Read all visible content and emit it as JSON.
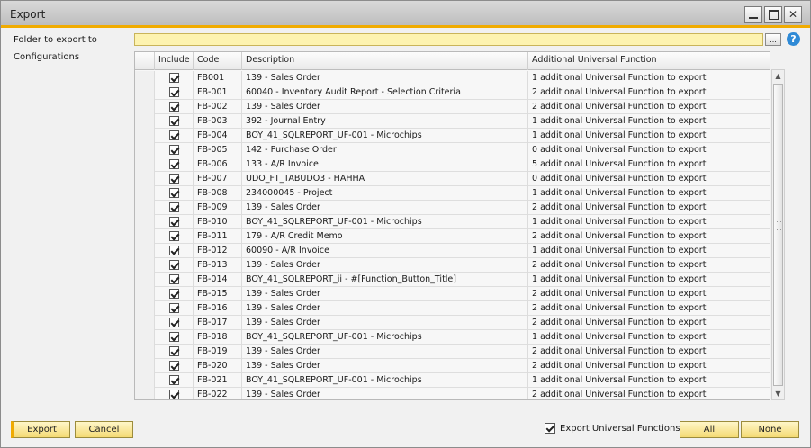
{
  "window": {
    "title": "Export"
  },
  "form": {
    "folder_label": "Folder to export to",
    "folder_value": "",
    "browse_label": "...",
    "help_label": "?",
    "configs_label": "Configurations"
  },
  "grid": {
    "columns": [
      "Include",
      "Code",
      "Description",
      "Additional Universal Function"
    ],
    "rows": [
      {
        "include": true,
        "code": "FB001",
        "description": "139 - Sales Order",
        "additional": "1 additional Universal Function to export"
      },
      {
        "include": true,
        "code": "FB-001",
        "description": "60040 - Inventory Audit Report - Selection Criteria",
        "additional": "2 additional Universal Function to export"
      },
      {
        "include": true,
        "code": "FB-002",
        "description": "139 - Sales Order",
        "additional": "2 additional Universal Function to export"
      },
      {
        "include": true,
        "code": "FB-003",
        "description": "392 - Journal Entry",
        "additional": "1 additional Universal Function to export"
      },
      {
        "include": true,
        "code": "FB-004",
        "description": "BOY_41_SQLREPORT_UF-001 - Microchips",
        "additional": "1 additional Universal Function to export"
      },
      {
        "include": true,
        "code": "FB-005",
        "description": "142 - Purchase Order",
        "additional": "0 additional Universal Function to export"
      },
      {
        "include": true,
        "code": "FB-006",
        "description": "133 - A/R Invoice",
        "additional": "5 additional Universal Function to export"
      },
      {
        "include": true,
        "code": "FB-007",
        "description": "UDO_FT_TABUDO3 - HAHHA",
        "additional": "0 additional Universal Function to export"
      },
      {
        "include": true,
        "code": "FB-008",
        "description": "234000045 - Project",
        "additional": "1 additional Universal Function to export"
      },
      {
        "include": true,
        "code": "FB-009",
        "description": "139 - Sales Order",
        "additional": "2 additional Universal Function to export"
      },
      {
        "include": true,
        "code": "FB-010",
        "description": "BOY_41_SQLREPORT_UF-001 - Microchips",
        "additional": "1 additional Universal Function to export"
      },
      {
        "include": true,
        "code": "FB-011",
        "description": "179 - A/R Credit Memo",
        "additional": "2 additional Universal Function to export"
      },
      {
        "include": true,
        "code": "FB-012",
        "description": "60090 - A/R Invoice",
        "additional": "1 additional Universal Function to export"
      },
      {
        "include": true,
        "code": "FB-013",
        "description": "139 - Sales Order",
        "additional": "2 additional Universal Function to export"
      },
      {
        "include": true,
        "code": "FB-014",
        "description": "BOY_41_SQLREPORT_ii - #[Function_Button_Title]",
        "additional": "1 additional Universal Function to export"
      },
      {
        "include": true,
        "code": "FB-015",
        "description": "139 - Sales Order",
        "additional": "2 additional Universal Function to export"
      },
      {
        "include": true,
        "code": "FB-016",
        "description": "139 - Sales Order",
        "additional": "2 additional Universal Function to export"
      },
      {
        "include": true,
        "code": "FB-017",
        "description": "139 - Sales Order",
        "additional": "2 additional Universal Function to export"
      },
      {
        "include": true,
        "code": "FB-018",
        "description": "BOY_41_SQLREPORT_UF-001 - Microchips",
        "additional": "1 additional Universal Function to export"
      },
      {
        "include": true,
        "code": "FB-019",
        "description": "139 - Sales Order",
        "additional": "2 additional Universal Function to export"
      },
      {
        "include": true,
        "code": "FB-020",
        "description": "139 - Sales Order",
        "additional": "2 additional Universal Function to export"
      },
      {
        "include": true,
        "code": "FB-021",
        "description": "BOY_41_SQLREPORT_UF-001 - Microchips",
        "additional": "1 additional Universal Function to export"
      },
      {
        "include": true,
        "code": "FB-022",
        "description": "139 - Sales Order",
        "additional": "2 additional Universal Function to export"
      }
    ]
  },
  "footer": {
    "export_label": "Export",
    "cancel_label": "Cancel",
    "export_uf_label": "Export Universal Functions",
    "export_uf_checked": true,
    "all_label": "All",
    "none_label": "None"
  },
  "icons": {
    "minimize": "minimize-icon",
    "maximize": "maximize-icon",
    "close": "close-icon",
    "help": "help-icon",
    "checkbox": "checkbox-checked-icon"
  },
  "colors": {
    "accent": "#f0ab00",
    "input_bg": "#fdf3b0",
    "button_bg": "#f4da74",
    "help_blue": "#2f8ad6"
  }
}
